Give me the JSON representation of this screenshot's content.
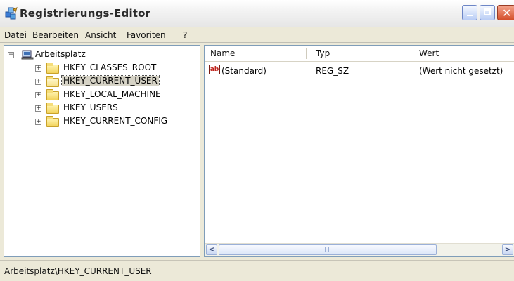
{
  "window": {
    "title": "Registrierungs-Editor"
  },
  "menu": [
    "Datei",
    "Bearbeiten",
    "Ansicht",
    "Favoriten",
    "?"
  ],
  "tree": {
    "root": "Arbeitsplatz",
    "items": [
      {
        "label": "HKEY_CLASSES_ROOT",
        "selected": false
      },
      {
        "label": "HKEY_CURRENT_USER",
        "selected": true
      },
      {
        "label": "HKEY_LOCAL_MACHINE",
        "selected": false
      },
      {
        "label": "HKEY_USERS",
        "selected": false
      },
      {
        "label": "HKEY_CURRENT_CONFIG",
        "selected": false
      }
    ]
  },
  "list": {
    "columns": [
      "Name",
      "Typ",
      "Wert"
    ],
    "rows": [
      {
        "icon": "ab",
        "name": "(Standard)",
        "type": "REG_SZ",
        "value": "(Wert nicht gesetzt)"
      }
    ]
  },
  "scrollbar": {
    "left": "<",
    "right": ">",
    "thumb_grip": "III"
  },
  "status": {
    "path": "Arbeitsplatz\\HKEY_CURRENT_USER"
  }
}
